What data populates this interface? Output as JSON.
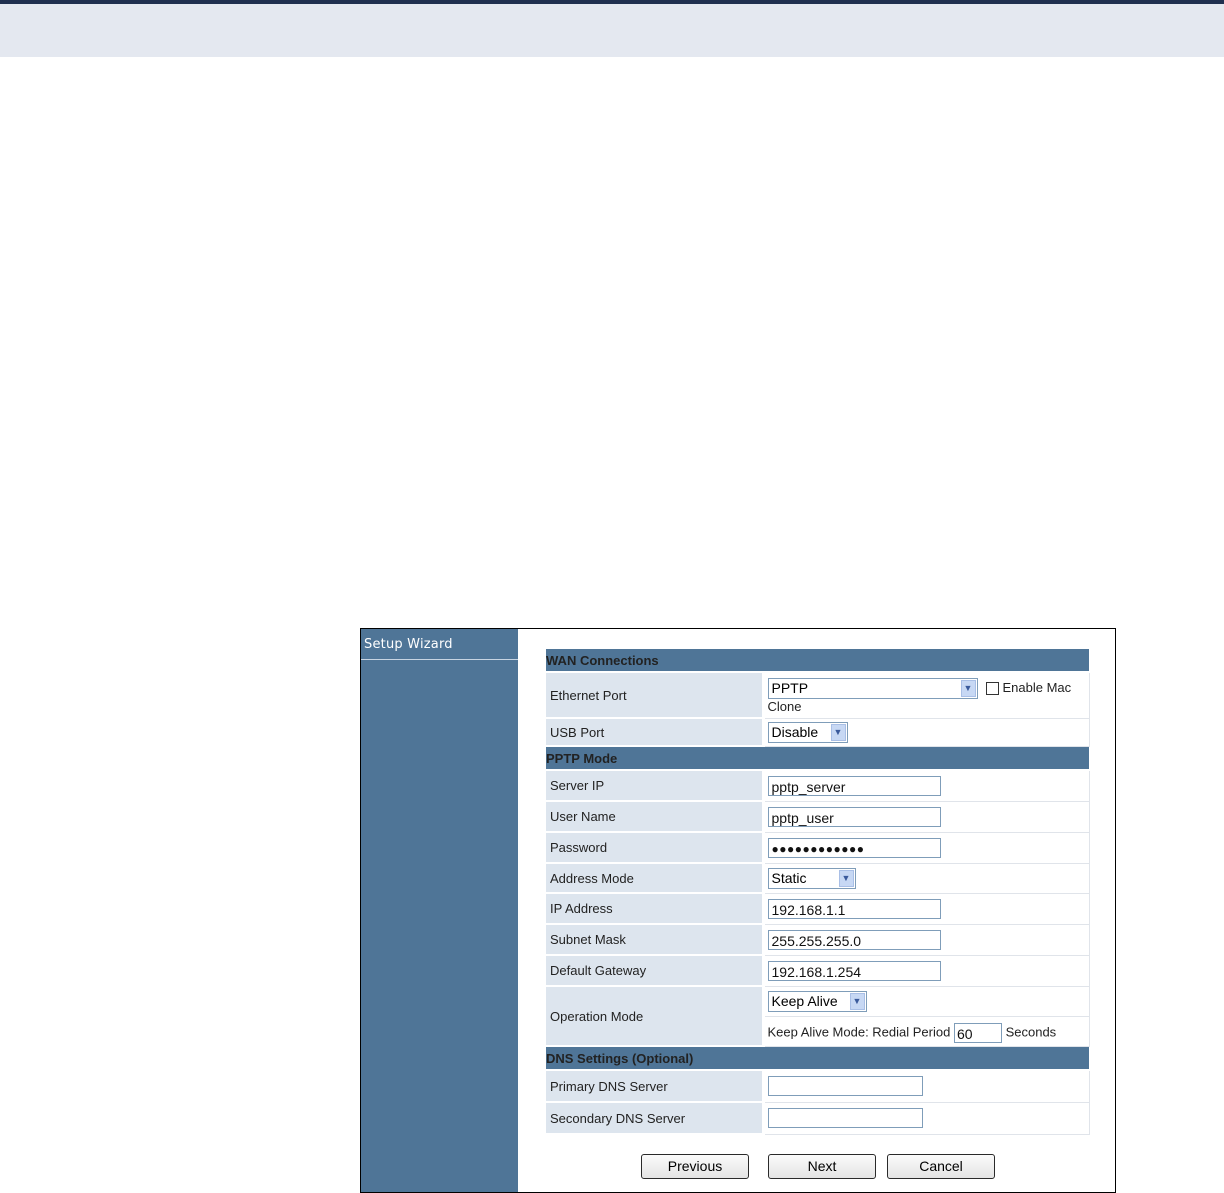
{
  "sidebar": {
    "items": [
      {
        "label": "Setup Wizard"
      }
    ]
  },
  "sections": {
    "wan": "WAN Connections",
    "pptp": "PPTP Mode",
    "dns": "DNS Settings (Optional)"
  },
  "wan": {
    "ethernet_port": {
      "label": "Ethernet Port",
      "value": "PPTP",
      "mac_clone_label_1": "Enable Mac",
      "mac_clone_label_2": "Clone"
    },
    "usb_port": {
      "label": "USB Port",
      "value": "Disable"
    }
  },
  "pptp": {
    "server_ip": {
      "label": "Server IP",
      "value": "pptp_server"
    },
    "user_name": {
      "label": "User Name",
      "value": "pptp_user"
    },
    "password": {
      "label": "Password",
      "value": "●●●●●●●●●●●●"
    },
    "address_mode": {
      "label": "Address Mode",
      "value": "Static"
    },
    "ip_address": {
      "label": "IP Address",
      "value": "192.168.1.1"
    },
    "subnet_mask": {
      "label": "Subnet Mask",
      "value": "255.255.255.0"
    },
    "default_gateway": {
      "label": "Default Gateway",
      "value": "192.168.1.254"
    },
    "operation_mode": {
      "label": "Operation Mode",
      "value": "Keep Alive",
      "redial_label": "Keep Alive Mode: Redial Period",
      "redial_value": "60",
      "redial_unit": "Seconds"
    }
  },
  "dns": {
    "primary": {
      "label": "Primary DNS Server",
      "value": ""
    },
    "secondary": {
      "label": "Secondary DNS Server",
      "value": ""
    }
  },
  "buttons": {
    "previous": "Previous",
    "next": "Next",
    "cancel": "Cancel"
  },
  "colors": {
    "sidebar": "#4f7597",
    "label_bg": "#dde5ee",
    "header_band": "#e4e8f0",
    "top_bar": "#1f2f4f"
  }
}
